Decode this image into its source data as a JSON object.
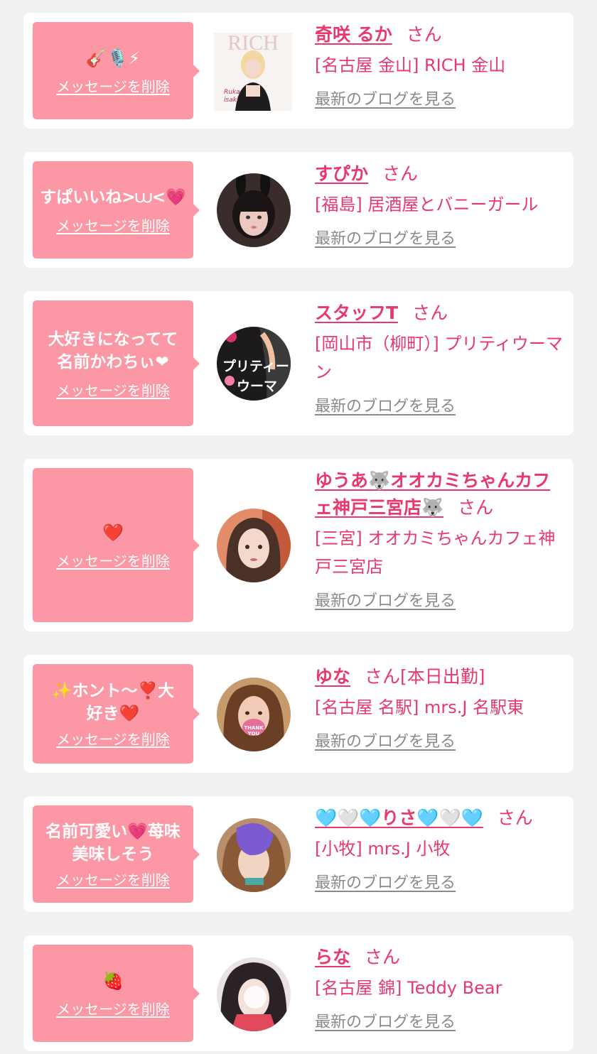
{
  "delete_label": "メッセージを削除",
  "blog_label": "最新のブログを見る",
  "san": "さん",
  "cards": [
    {
      "message": "🎸🎙️⚡",
      "name": "奇咲 るか",
      "suffix": "",
      "shop": "[名古屋 金山] RICH 金山"
    },
    {
      "message": "すぱいいね>⩊<💗",
      "name": "すぴか",
      "suffix": "",
      "shop": "[福島] 居酒屋とバニーガール"
    },
    {
      "message": "大好きになってて\n名前かわちぃ❤",
      "name": "スタッフT",
      "suffix": "",
      "shop": "[岡山市（柳町）] プリティウーマン"
    },
    {
      "message": "❤️",
      "name": "ゆうあ🐺オオカミちゃんカフェ神戸三宮店🐺",
      "suffix": "",
      "shop": "[三宮] オオカミちゃんカフェ神戸三宮店"
    },
    {
      "message": "✨ホント〜❣️大好き❤️",
      "name": "ゆな",
      "suffix": "[本日出勤]",
      "shop": "[名古屋 名駅] mrs.J 名駅東"
    },
    {
      "message": "名前可愛い💗苺味美味しそう",
      "name": "🩵🤍🩵りさ🩵🤍🩵",
      "suffix": "",
      "shop": "[小牧] mrs.J 小牧"
    },
    {
      "message": "🍓",
      "name": "らな",
      "suffix": "",
      "shop": "[名古屋 錦] Teddy Bear"
    }
  ]
}
